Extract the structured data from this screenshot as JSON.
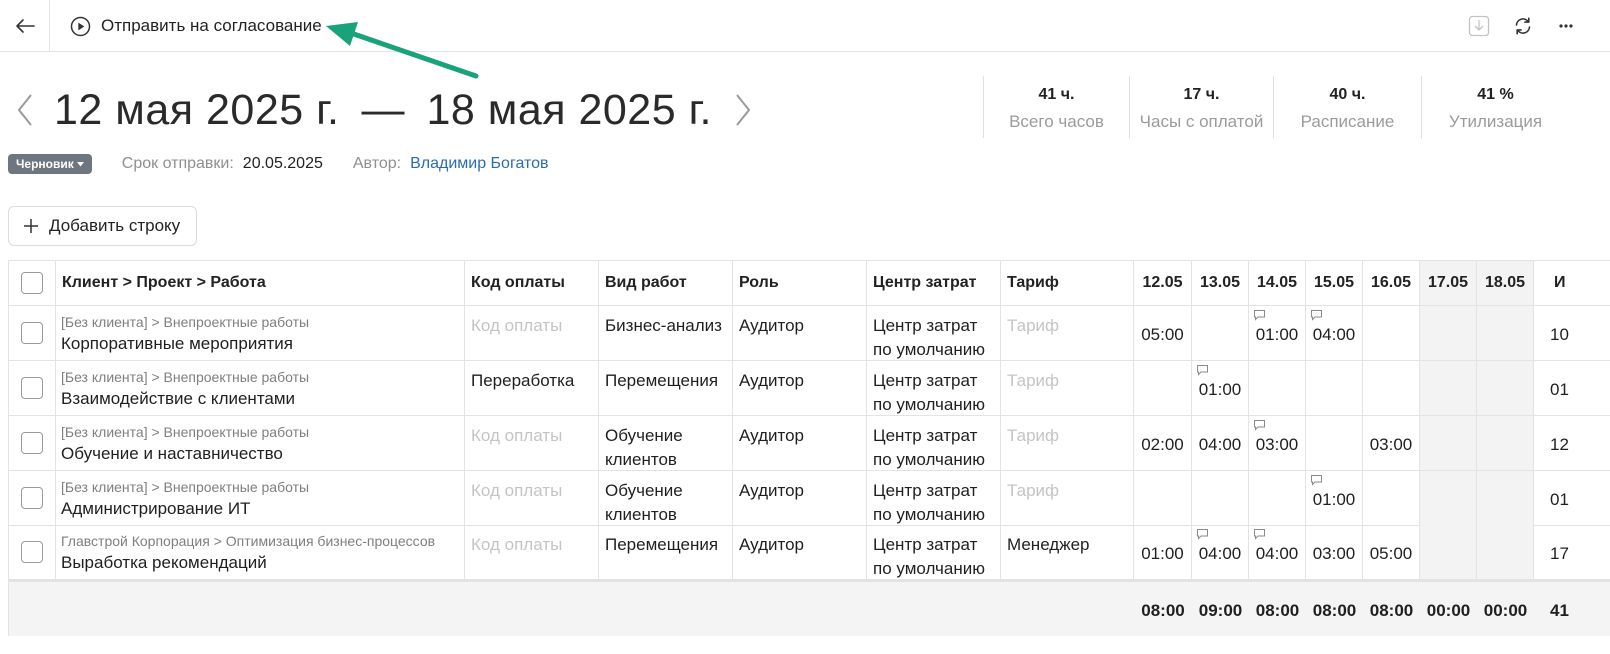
{
  "toolbar": {
    "submit_label": "Отправить на согласование"
  },
  "period": {
    "start": "12 мая 2025 г.",
    "separator": "—",
    "end": "18 мая 2025 г."
  },
  "stats": [
    {
      "value": "41 ч.",
      "label": "Всего часов"
    },
    {
      "value": "17 ч.",
      "label": "Часы с оплатой"
    },
    {
      "value": "40 ч.",
      "label": "Расписание"
    },
    {
      "value": "41 %",
      "label": "Утилизация"
    }
  ],
  "meta": {
    "status_badge": "Черновик",
    "deadline_label": "Срок отправки:",
    "deadline_value": "20.05.2025",
    "author_label": "Автор:",
    "author_value": "Владимир Богатов"
  },
  "add_row_label": "Добавить строку",
  "table": {
    "headers": {
      "task": "Клиент > Проект > Работа",
      "pay_code": "Код оплаты",
      "work_type": "Вид работ",
      "role": "Роль",
      "cost_center": "Центр затрат",
      "rate": "Тариф",
      "days": [
        "12.05",
        "13.05",
        "14.05",
        "15.05",
        "16.05",
        "17.05",
        "18.05"
      ],
      "total": "И"
    },
    "rows": [
      {
        "path": "[Без клиента] > Внепроектные работы",
        "task": "Корпоративные мероприятия",
        "pay_code": "Код оплаты",
        "work_type": [
          "Бизнес-анализ"
        ],
        "role": "Аудитор",
        "cost_center": [
          "Центр затрат",
          "по умолчанию"
        ],
        "rate": "Тариф",
        "hours": [
          "05:00",
          "",
          "01:00",
          "04:00",
          "",
          "",
          ""
        ],
        "total": "10"
      },
      {
        "path": "[Без клиента] > Внепроектные работы",
        "task": "Взаимодействие с клиентами",
        "pay_code": "Переработка",
        "work_type": [
          "Перемещения"
        ],
        "role": "Аудитор",
        "cost_center": [
          "Центр затрат",
          "по умолчанию"
        ],
        "rate": "Тариф",
        "hours": [
          "",
          "01:00",
          "",
          "",
          "",
          "",
          ""
        ],
        "total": "01"
      },
      {
        "path": "[Без клиента] > Внепроектные работы",
        "task": "Обучение и наставничество",
        "pay_code": "Код оплаты",
        "work_type": [
          "Обучение",
          "клиентов"
        ],
        "role": "Аудитор",
        "cost_center": [
          "Центр затрат",
          "по умолчанию"
        ],
        "rate": "Тариф",
        "hours": [
          "02:00",
          "04:00",
          "03:00",
          "",
          "03:00",
          "",
          ""
        ],
        "total": "12"
      },
      {
        "path": "[Без клиента] > Внепроектные работы",
        "task": "Администрирование ИТ",
        "pay_code": "Код оплаты",
        "work_type": [
          "Обучение",
          "клиентов"
        ],
        "role": "Аудитор",
        "cost_center": [
          "Центр затрат",
          "по умолчанию"
        ],
        "rate": "Тариф",
        "hours": [
          "",
          "",
          "",
          "01:00",
          "",
          "",
          ""
        ],
        "total": "01"
      },
      {
        "path": "Главстрой Корпорация > Оптимизация бизнес-процессов",
        "task": "Выработка рекомендаций",
        "pay_code": "Код оплаты",
        "work_type": [
          "Перемещения"
        ],
        "role": "Аудитор",
        "cost_center": [
          "Центр затрат",
          "по умолчанию"
        ],
        "rate": "Менеджер",
        "hours": [
          "01:00",
          "04:00",
          "04:00",
          "03:00",
          "05:00",
          "",
          ""
        ],
        "total": "17"
      }
    ],
    "footer": {
      "days": [
        "08:00",
        "09:00",
        "08:00",
        "08:00",
        "08:00",
        "00:00",
        "00:00"
      ],
      "total": "41"
    }
  },
  "colors": {
    "link": "#2b6cb0",
    "badge_bg": "#6e7680",
    "placeholder": "#c4c4c4",
    "annotation_arrow": "#1aa37a"
  },
  "icons": [
    "back-arrow-icon",
    "play-circle-icon",
    "download-icon",
    "refresh-icon",
    "more-icon",
    "chevron-left-icon",
    "chevron-right-icon",
    "plus-icon",
    "caret-down-icon",
    "comment-icon"
  ]
}
